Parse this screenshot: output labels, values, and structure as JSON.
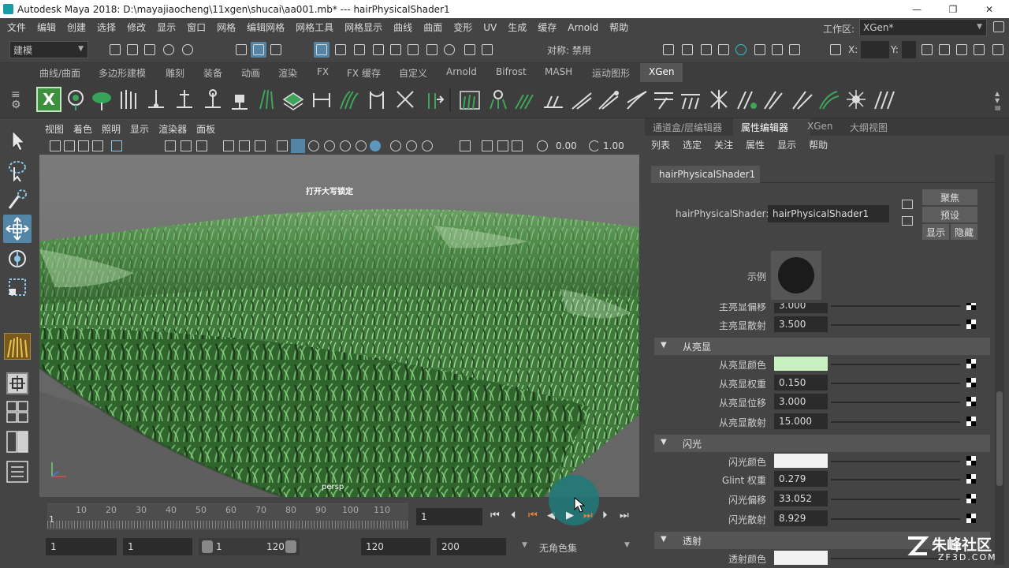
{
  "window": {
    "title": "Autodesk Maya 2018: D:\\mayajiaocheng\\11xgen\\shucai\\aa001.mb*   ---   hairPhysicalShader1",
    "minimize": "—",
    "restore": "❐",
    "close": "✕"
  },
  "menubar": {
    "items": [
      "文件",
      "编辑",
      "创建",
      "选择",
      "修改",
      "显示",
      "窗口",
      "网格",
      "编辑网格",
      "网格工具",
      "网格显示",
      "曲线",
      "曲面",
      "变形",
      "UV",
      "生成",
      "缓存",
      "Arnold",
      "帮助"
    ],
    "workspace_label": "工作区:",
    "workspace_value": "XGen*"
  },
  "toolbar": {
    "mode": "建模",
    "symmetry": "对称: 禁用",
    "x_label": "X:",
    "y_label": "Y:"
  },
  "shelf": {
    "tabs": [
      "曲线/曲面",
      "多边形建模",
      "雕刻",
      "装备",
      "动画",
      "渲染",
      "FX",
      "FX 缓存",
      "自定义",
      "Arnold",
      "Bifrost",
      "MASH",
      "运动图形",
      "XGen"
    ],
    "active_tab": "XGen"
  },
  "viewport": {
    "menu": [
      "视图",
      "着色",
      "照明",
      "显示",
      "渲染器",
      "面板"
    ],
    "field1": "0.00",
    "field2": "1.00",
    "hud_text": "打开大写锁定",
    "camera_label": "persp"
  },
  "timeline": {
    "ticks": [
      "10",
      "20",
      "30",
      "40",
      "50",
      "60",
      "70",
      "80",
      "90",
      "100",
      "110"
    ],
    "start_tick": "1",
    "current_frame": "1"
  },
  "range": {
    "start": "1",
    "playback_start": "1",
    "slider_start": "1",
    "slider_end": "120",
    "playback_end": "120",
    "end": "200",
    "char_set": "无角色集"
  },
  "panel": {
    "tabs": [
      "通道盒/层编辑器",
      "属性编辑器",
      "XGen",
      "大纲视图"
    ],
    "active_tab": "属性编辑器",
    "menu": [
      "列表",
      "选定",
      "关注",
      "属性",
      "显示",
      "帮助"
    ],
    "node_tab": "hairPhysicalShader1",
    "node_type_label": "hairPhysicalShader:",
    "node_name": "hairPhysicalShader1",
    "buttons": {
      "focus": "聚焦",
      "presets": "预设",
      "show": "显示",
      "hide": "隐藏"
    },
    "sample_label": "示例",
    "rows_top": [
      {
        "label": "主亮显偏移",
        "value": "3.000",
        "pos": 0.6
      },
      {
        "label": "主亮显散射",
        "value": "3.500",
        "pos": 0.35
      }
    ],
    "sections": [
      {
        "title": "从亮显",
        "rows": [
          {
            "label": "从亮显颜色",
            "swatch": "#c9f0c0",
            "pos": 0.98
          },
          {
            "label": "从亮显权重",
            "value": "0.150",
            "pos": 0.15
          },
          {
            "label": "从亮显位移",
            "value": "3.000",
            "pos": 0.6
          },
          {
            "label": "从亮显散射",
            "value": "15.000",
            "pos": 0.75
          }
        ]
      },
      {
        "title": "闪光",
        "rows": [
          {
            "label": "闪光颜色",
            "swatch": "#f2f2f2",
            "pos": 0.98
          },
          {
            "label": "Glint 权重",
            "value": "0.279",
            "pos": 0.28
          },
          {
            "label": "闪光偏移",
            "value": "33.052",
            "pos": 0.4
          },
          {
            "label": "闪光散射",
            "value": "8.929",
            "pos": 0.36
          }
        ]
      },
      {
        "title": "透射",
        "rows": [
          {
            "label": "透射颜色",
            "swatch": "#f2f2f2",
            "pos": 0.98
          }
        ]
      }
    ]
  },
  "watermark": {
    "brand": "朱峰社区",
    "site": "ZF3D.COM"
  },
  "colors": {
    "accent": "#5285a6",
    "grass_dark": "#2f5a2c",
    "grass_light": "#8fc48a",
    "cursor_circle": "#1f7a7a"
  }
}
